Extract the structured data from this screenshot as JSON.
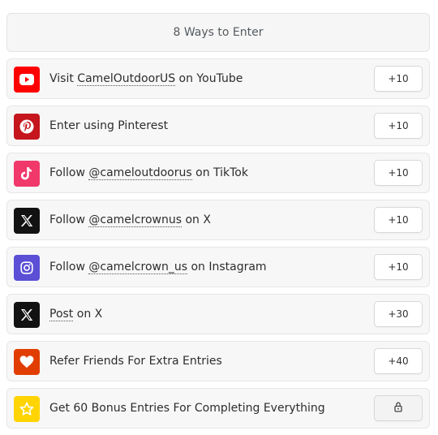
{
  "header": {
    "title": "8 Ways to Enter"
  },
  "entries": [
    {
      "icon": "youtube-icon",
      "color": "#ff0000",
      "label_pre": "Visit ",
      "label_link": "CamelOutdoorUS",
      "label_post": " on YouTube",
      "points": "+10"
    },
    {
      "icon": "pinterest-icon",
      "color": "#c4161c",
      "label_pre": "Enter using Pinterest",
      "label_link": "",
      "label_post": "",
      "points": "+10"
    },
    {
      "icon": "tiktok-icon",
      "color": "#f0386b",
      "label_pre": "Follow ",
      "label_link": "@cameloutdoorus",
      "label_post": " on TikTok",
      "points": "+10"
    },
    {
      "icon": "x-icon",
      "color": "#121212",
      "label_pre": "Follow ",
      "label_link": "@camelcrownus",
      "label_post": " on X",
      "points": "+10"
    },
    {
      "icon": "instagram-icon",
      "color": "#5b4fd6",
      "label_pre": "Follow ",
      "label_link": "@camelcrown_us",
      "label_post": " on Instagram",
      "points": "+10"
    },
    {
      "icon": "x-icon",
      "color": "#121212",
      "label_pre": "",
      "label_link": "Post",
      "label_post": " on X",
      "points": "+30"
    },
    {
      "icon": "heart-icon",
      "color": "#e23d00",
      "label_pre": "Refer Friends For Extra Entries",
      "label_link": "",
      "label_post": "",
      "points": "+40"
    },
    {
      "icon": "star-icon",
      "color": "#ffd400",
      "label_pre": "Get 60 Bonus Entries For Completing Everything",
      "label_link": "",
      "label_post": "",
      "points": "lock-icon"
    }
  ]
}
